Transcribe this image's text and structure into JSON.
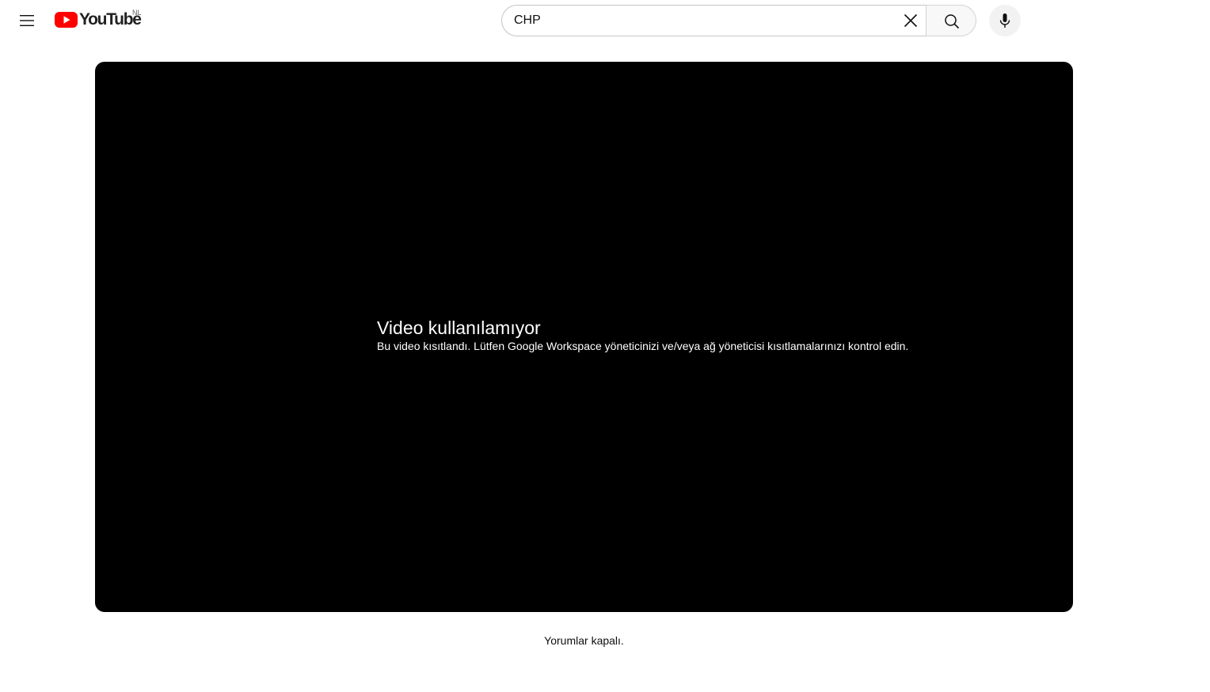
{
  "masthead": {
    "logo_text": "YouTube",
    "country_code": "NL",
    "brand_color": "#ff0000",
    "menu_icon": "hamburger-menu-icon",
    "search": {
      "value": "CHP",
      "clear_icon": "close-icon",
      "search_icon": "search-icon"
    },
    "voice_icon": "microphone-icon"
  },
  "player": {
    "background": "#000000",
    "error_title": "Video kullanılamıyor",
    "error_subtitle": "Bu video kısıtlandı. Lütfen Google Workspace yöneticinizi ve/veya ağ yöneticisi kısıtlamalarınızı kontrol edin."
  },
  "comments": {
    "status_text": "Yorumlar kapalı."
  }
}
